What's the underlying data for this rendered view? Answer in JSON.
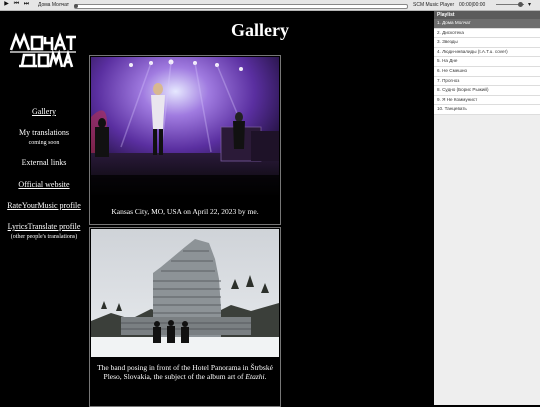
{
  "player": {
    "song": "Дома Молчат",
    "name": "SCM Music Player",
    "time": "00:00|00:00",
    "progress": 0.0,
    "volume": 0.8,
    "icons": [
      "play-icon",
      "prev-icon",
      "next-icon",
      "volume-icon"
    ]
  },
  "page": {
    "title": "Gallery"
  },
  "logo": {
    "text": "МОЛЧАТ ДОМА"
  },
  "nav": {
    "gallery": "Gallery",
    "translations": "My translations",
    "coming_soon": "coming soon",
    "external": "External links",
    "official": "Official website",
    "rym": "RateYourMusic profile",
    "lyrics": "LyricsTranslate profile",
    "lyrics_note": "(other people's translations)"
  },
  "gallery": [
    {
      "caption": "Kansas City, MO, USA on April 22, 2023 by me."
    },
    {
      "caption_a": "The band posing in front of the Hotel Panorama in Štrbské Pleso, Slovakia, the subject of the album art of ",
      "caption_em": "Etazhi",
      "caption_b": "."
    }
  ],
  "playlist": {
    "header": "Playlist",
    "items": [
      "1. Дома Молчат",
      "2. Дискотека",
      "3. Звезды",
      "4. Люди-инвалиды (t.A.T.u. cover)",
      "5. На Дне",
      "6. Не Смешно",
      "7. Прогноз",
      "8. Судно (Борис Рыжий)",
      "9. Я Не Коммунист",
      "10. Танцевать"
    ],
    "active_index": 0
  },
  "colors": {
    "background": "#000000",
    "text": "#ffffff",
    "playlist_active": "#6e6e6e"
  }
}
